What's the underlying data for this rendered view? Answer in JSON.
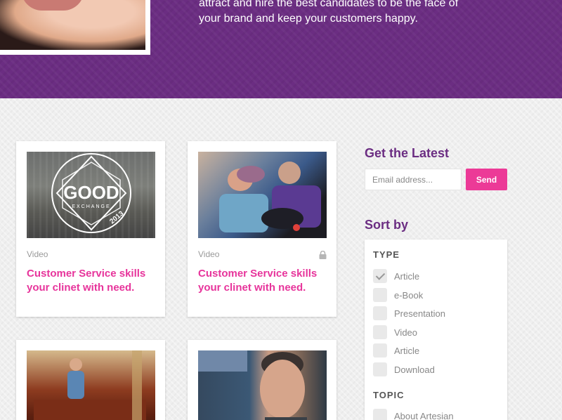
{
  "hero": {
    "text": "attract and hire the best candidates to be the face of your brand and keep your customers happy."
  },
  "cards": [
    {
      "type": "Video",
      "title": "Customer Service skills your clinet with need.",
      "thumb_caption": "GOOD EXCHANGE 2013",
      "locked": false
    },
    {
      "type": "Video",
      "title": "Customer Service skills your clinet with need.",
      "locked": true
    }
  ],
  "sidebar": {
    "latest_heading": "Get the Latest",
    "email_placeholder": "Email address...",
    "send_label": "Send",
    "sort_heading": "Sort by",
    "type_heading": "TYPE",
    "type_items": [
      {
        "label": "Article",
        "checked": true
      },
      {
        "label": "e-Book",
        "checked": false
      },
      {
        "label": "Presentation",
        "checked": false
      },
      {
        "label": "Video",
        "checked": false
      },
      {
        "label": "Article",
        "checked": false
      },
      {
        "label": "Download",
        "checked": false
      }
    ],
    "topic_heading": "TOPIC",
    "topic_items": [
      {
        "label": "About Artesian",
        "checked": false
      }
    ]
  },
  "colors": {
    "brand_purple": "#6b2d82",
    "accent_pink": "#ec3a97",
    "title_pink": "#e7349b"
  }
}
